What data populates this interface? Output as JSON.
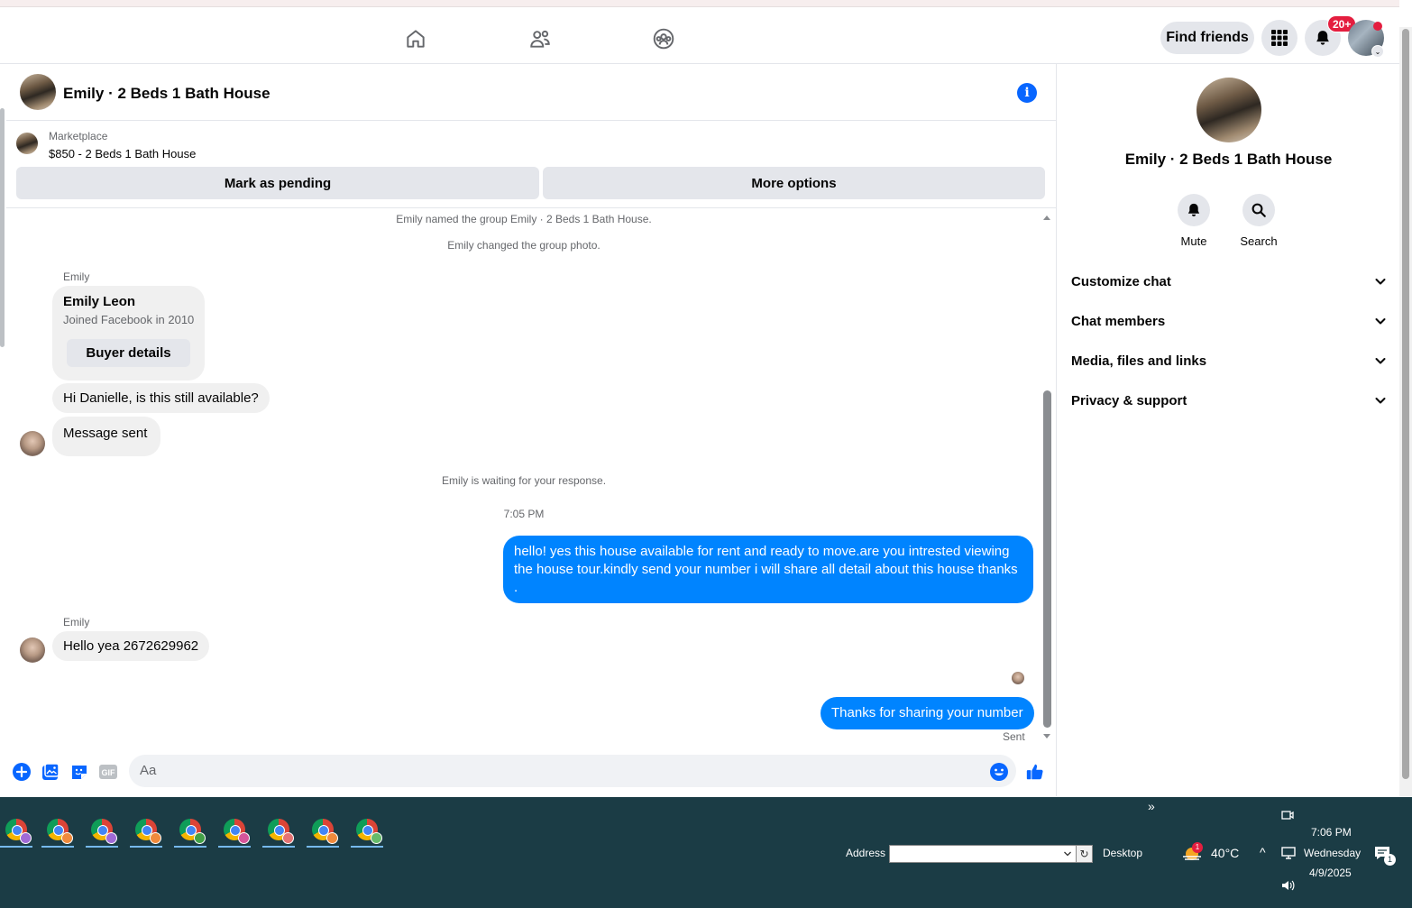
{
  "topnav": {
    "find_friends": "Find friends",
    "notif_badge": "20+"
  },
  "chat": {
    "title": "Emily · 2 Beds 1 Bath House",
    "marketplace_label": "Marketplace",
    "listing": "$850 - 2 Beds 1 Bath House",
    "mark_pending": "Mark as pending",
    "more_options": "More options",
    "system_messages": [
      "Emily named the group Emily · 2 Beds 1 Bath House.",
      "Emily changed the group photo.",
      "Emily is waiting for your response."
    ],
    "sender_name": "Emily",
    "card": {
      "name": "Emily Leon",
      "sub": "Joined Facebook in 2010",
      "button": "Buyer details"
    },
    "msg_in_1": "Hi Danielle, is this still available?",
    "msg_in_2": "Message sent",
    "timestamp": "7:05 PM",
    "msg_out_1": "hello! yes this house available for rent and ready to move.are you intrested viewing the house tour.kindly send your number i will share all detail about this house thanks .",
    "msg_in_3": "Hello yea 2672629962",
    "msg_out_2": "Thanks for sharing your number",
    "status": "Sent",
    "composer_placeholder": "Aa"
  },
  "right_panel": {
    "title": "Emily · 2 Beds 1 Bath House",
    "actions": [
      "Mute",
      "Search"
    ],
    "rows": [
      "Customize chat",
      "Chat members",
      "Media, files and links",
      "Privacy & support"
    ]
  },
  "taskbar": {
    "address_label": "Address",
    "desktop_label": "Desktop",
    "temperature": "40°C",
    "weather_badge": "1",
    "time": "7:06 PM",
    "day": "Wednesday",
    "date": "4/9/2025",
    "notif_count": "1"
  },
  "colors": {
    "accent_blue": "#0866ff",
    "bubble_out": "#0084ff",
    "badge_red": "#e41e3f",
    "taskbar_bg": "#1b3c45"
  },
  "icons": [
    "home-icon",
    "friends-icon",
    "groups-icon",
    "menu-grid-icon",
    "bell-icon",
    "info-icon",
    "plus-icon",
    "image-icon",
    "sticker-icon",
    "gif-icon",
    "emoji-icon",
    "thumbs-up-icon",
    "search-icon",
    "chevron-down-icon",
    "chrome-icon"
  ]
}
